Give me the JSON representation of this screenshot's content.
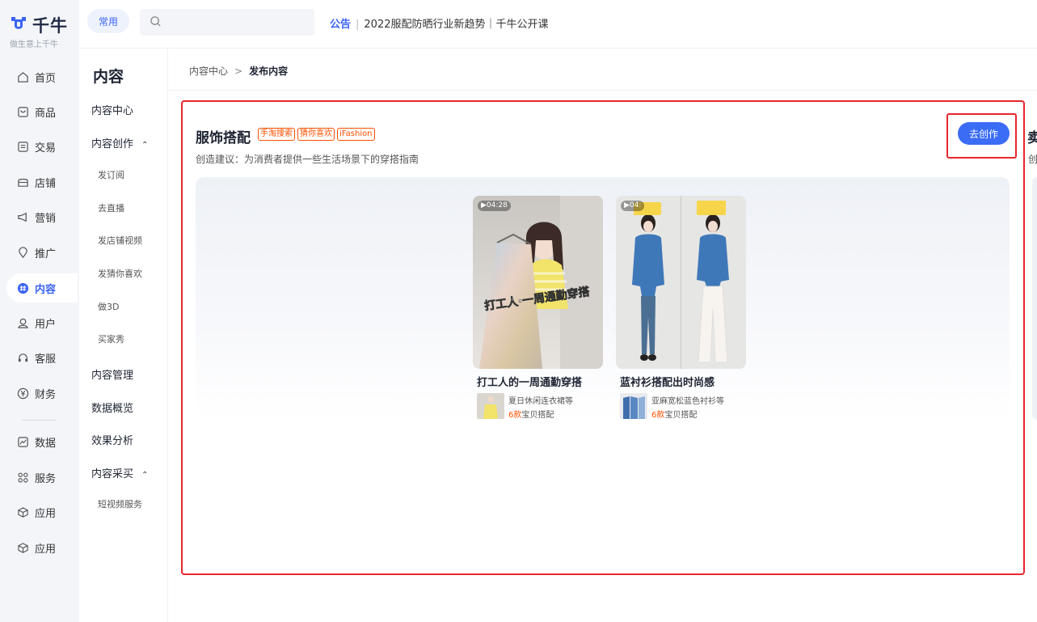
{
  "app": {
    "logo_text": "千牛",
    "slogan": "做生意上千牛"
  },
  "leftnav": {
    "items": [
      {
        "label": "首页",
        "icon": "home-icon"
      },
      {
        "label": "商品",
        "icon": "product-icon"
      },
      {
        "label": "交易",
        "icon": "trade-icon"
      },
      {
        "label": "店铺",
        "icon": "shop-icon"
      },
      {
        "label": "营销",
        "icon": "megaphone-icon"
      },
      {
        "label": "推广",
        "icon": "location-icon"
      },
      {
        "label": "内容",
        "icon": "hashtag-icon",
        "active": true
      },
      {
        "label": "用户",
        "icon": "user-icon"
      },
      {
        "label": "客服",
        "icon": "headset-icon"
      },
      {
        "label": "财务",
        "icon": "yuan-icon"
      },
      {
        "label": "数据",
        "icon": "chart-icon"
      },
      {
        "label": "服务",
        "icon": "grid-icon"
      },
      {
        "label": "应用",
        "icon": "cube-icon"
      },
      {
        "label": "应用",
        "icon": "cube-icon"
      }
    ]
  },
  "topbar": {
    "common_label": "常用",
    "search_placeholder": "",
    "notice_tag": "公告",
    "notice_text": "2022服配防晒行业新趋势｜千牛公开课"
  },
  "subnav": {
    "title": "内容",
    "items": [
      {
        "label": "内容中心",
        "level": 1
      },
      {
        "label": "内容创作",
        "level": 1,
        "expanded": true
      },
      {
        "label": "发订阅",
        "level": 2
      },
      {
        "label": "去直播",
        "level": 2
      },
      {
        "label": "发店铺视频",
        "level": 2
      },
      {
        "label": "发猜你喜欢",
        "level": 2
      },
      {
        "label": "做3D",
        "level": 2
      },
      {
        "label": "买家秀",
        "level": 2
      },
      {
        "label": "内容管理",
        "level": 1
      },
      {
        "label": "数据概览",
        "level": 1
      },
      {
        "label": "效果分析",
        "level": 1
      },
      {
        "label": "内容采买",
        "level": 1,
        "expanded": true
      },
      {
        "label": "短视频服务",
        "level": 2
      }
    ]
  },
  "breadcrumb": {
    "parent": "内容中心",
    "separator": ">",
    "current": "发布内容"
  },
  "card": {
    "title": "服饰搭配",
    "tags": [
      "手淘搜索",
      "猜你喜欢",
      "iFashion"
    ],
    "description": "创造建议：为消费者提供一些生活场景下的穿搭指南",
    "create_button": "去创作",
    "videos": [
      {
        "duration": "▶04:28",
        "overlay_text": "打工人·一周通勤穿搭",
        "title": "打工人的一周通勤穿搭",
        "product_name": "夏日休闲连衣裙等",
        "count_num": "6款",
        "count_suffix": "宝贝搭配"
      },
      {
        "duration": "▶04:",
        "overlay_text": "",
        "title": "蓝衬衫搭配出时尚感",
        "product_name": "亚麻宽松蓝色衬衫等",
        "count_num": "6款",
        "count_suffix": "宝贝搭配"
      }
    ]
  },
  "next_card": {
    "title_fragment": "卖",
    "desc_fragment": "创"
  },
  "colors": {
    "accent": "#3a63f3",
    "button": "#3a6cf5",
    "tag": "#ff5000",
    "highlight_box": "#e8262d"
  }
}
